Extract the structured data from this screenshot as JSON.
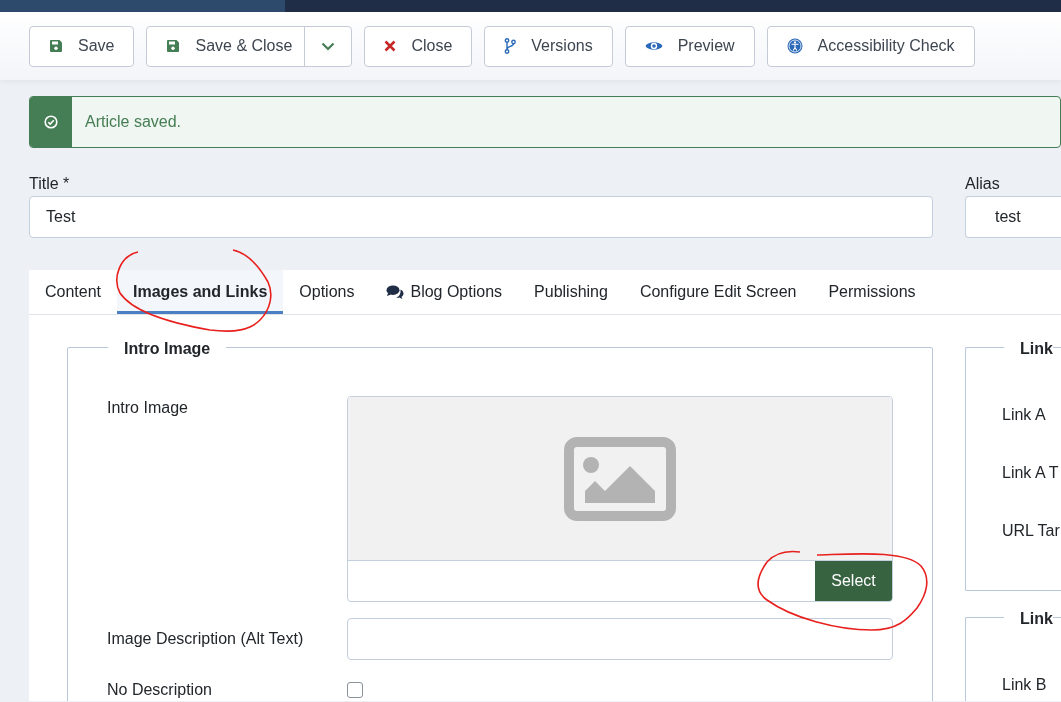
{
  "toolbar": {
    "buttons": [
      {
        "kind": "save",
        "label": "Save"
      },
      {
        "kind": "save-split",
        "label": "Save & Close"
      },
      {
        "kind": "close",
        "label": "Close"
      },
      {
        "kind": "versions",
        "label": "Versions"
      },
      {
        "kind": "preview",
        "label": "Preview"
      },
      {
        "kind": "accessibility",
        "label": "Accessibility Check"
      }
    ]
  },
  "alert": {
    "message": "Article saved."
  },
  "title_field": {
    "label": "Title *",
    "value": "Test"
  },
  "alias_field": {
    "label": "Alias",
    "value": "test"
  },
  "tabs": [
    {
      "label": "Content",
      "selected": false
    },
    {
      "label": "Images and Links",
      "selected": true
    },
    {
      "label": "Options",
      "selected": false
    },
    {
      "label": "Blog Options",
      "selected": false,
      "icon": true
    },
    {
      "label": "Publishing",
      "selected": false
    },
    {
      "label": "Configure Edit Screen",
      "selected": false
    },
    {
      "label": "Permissions",
      "selected": false
    }
  ],
  "intro_image": {
    "legend": "Intro Image",
    "image_label": "Intro Image",
    "select_button": "Select",
    "alt_label": "Image Description (Alt Text)",
    "no_description_label": "No Description",
    "no_description_checked": false
  },
  "link_a": {
    "legend": "Link",
    "rows": [
      "Link A",
      "Link A T",
      "URL Tar"
    ]
  },
  "link_b": {
    "legend": "Link",
    "rows": [
      "Link B"
    ]
  }
}
